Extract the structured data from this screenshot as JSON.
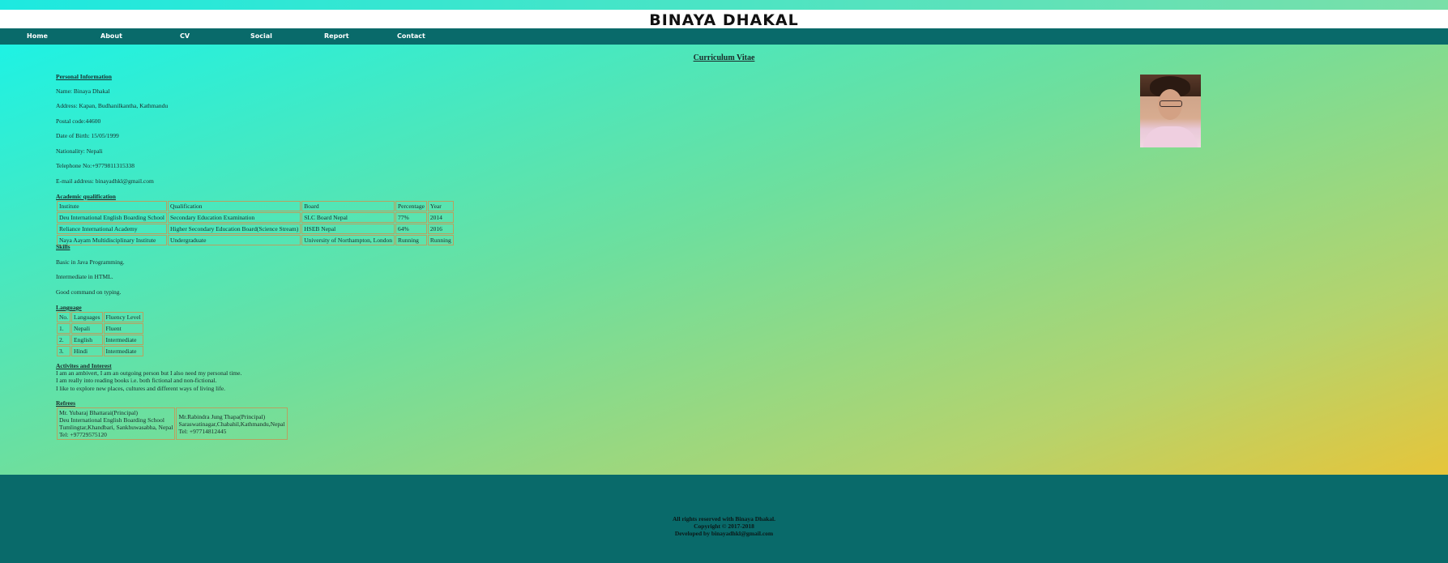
{
  "site": {
    "title": "BINAYA DHAKAL"
  },
  "nav": {
    "items": [
      "Home",
      "About",
      "CV",
      "Social",
      "Report",
      "Contact"
    ]
  },
  "cv": {
    "title": "Curriculum Vitae",
    "personal_heading": "Personal Information",
    "personal": [
      "Name: Binaya Dhakal",
      "Address: Kapan, Budhanilkantha, Kathmandu",
      "Postal code:44600",
      "Date of Birth: 15/05/1999",
      "Nationality: Nepali",
      "Telephone No:+9779811315338",
      "E-mail address: binayadhkl@gmail.com"
    ],
    "academic_heading": "Academic qualification",
    "academic_rows": [
      [
        "Institute",
        "Qualification",
        "Board",
        "Percentage",
        "Year"
      ],
      [
        "Deu International English Boarding School",
        "Secondary Education Examination",
        "SLC Board Nepal",
        "77%",
        "2014"
      ],
      [
        "Reliance International Academy",
        "Higher Secondary Education Board(Science Stream)",
        "HSEB Nepal",
        "64%",
        "2016"
      ],
      [
        "Naya Aayam Multidisciplinary Institute",
        "Undergraduate",
        "University of Northampton, London",
        "Running",
        "Running"
      ]
    ],
    "skills_heading": "Skills",
    "skills": [
      "Basic in Java Programming.",
      "Intermediate in HTML.",
      "Good command on typing."
    ],
    "language_heading": "Language",
    "language_rows": [
      [
        "No.",
        "Languages",
        "Fluency Level"
      ],
      [
        "1.",
        "Nepali",
        "Fluent"
      ],
      [
        "2.",
        "English",
        "Intermediate"
      ],
      [
        "3.",
        "Hindi",
        "Intermediate"
      ]
    ],
    "activities_heading": "Activites and Interest",
    "activities": [
      "I am an ambivert, I am an outgoing person but I also need my personal time.",
      "I am really into reading books i.e. both fictional and non-fictional.",
      "I like to explore new places, cultures and different ways of living life."
    ],
    "refrees_heading": "Refrees",
    "refrees": [
      [
        "Mr. Yubaraj Bhattarai(Principal)",
        "Deu International English Boarding School",
        "Tumlingtar,Khandbari, Sankhuwasabha, Nepal",
        "Tel: +97729575120"
      ],
      [
        "Mr.Rabindra Jung Thapa(Principal)",
        "Saraswatinagar,Chabahil,Kathmandu,Nepal",
        "Tel: +97714812445"
      ]
    ]
  },
  "footer": {
    "lines": [
      "All rights reserved with Binaya Dhakal.",
      "Copyright © 2017-2018",
      "Developed by binayadhkl@gmail.com"
    ]
  }
}
